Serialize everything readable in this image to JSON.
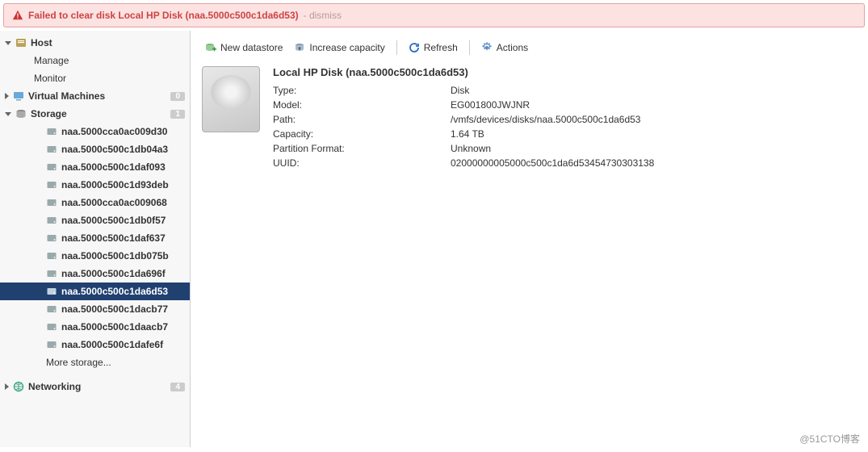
{
  "alert": {
    "text": "Failed to clear disk Local HP Disk (naa.5000c500c1da6d53)",
    "dismiss": "- dismiss"
  },
  "tree": {
    "host": "Host",
    "host_children": [
      "Manage",
      "Monitor"
    ],
    "vm": "Virtual Machines",
    "vm_badge": "0",
    "storage": "Storage",
    "storage_badge": "1",
    "storage_children": [
      "naa.5000cca0ac009d30",
      "naa.5000c500c1db04a3",
      "naa.5000c500c1daf093",
      "naa.5000c500c1d93deb",
      "naa.5000cca0ac009068",
      "naa.5000c500c1db0f57",
      "naa.5000c500c1daf637",
      "naa.5000c500c1db075b",
      "naa.5000c500c1da696f",
      "naa.5000c500c1da6d53",
      "naa.5000c500c1dacb77",
      "naa.5000c500c1daacb7",
      "naa.5000c500c1dafe6f"
    ],
    "storage_selected_index": 9,
    "more_storage": "More storage...",
    "networking": "Networking",
    "networking_badge": "4"
  },
  "toolbar": {
    "new_datastore": "New datastore",
    "increase_capacity": "Increase capacity",
    "refresh": "Refresh",
    "actions": "Actions"
  },
  "detail": {
    "title": "Local HP Disk (naa.5000c500c1da6d53)",
    "rows": [
      {
        "k": "Type:",
        "v": "Disk"
      },
      {
        "k": "Model:",
        "v": "EG001800JWJNR"
      },
      {
        "k": "Path:",
        "v": "/vmfs/devices/disks/naa.5000c500c1da6d53"
      },
      {
        "k": "Capacity:",
        "v": "1.64 TB"
      },
      {
        "k": "Partition Format:",
        "v": "Unknown"
      },
      {
        "k": "UUID:",
        "v": "02000000005000c500c1da6d53454730303138"
      }
    ]
  },
  "watermark": "@51CTO博客"
}
